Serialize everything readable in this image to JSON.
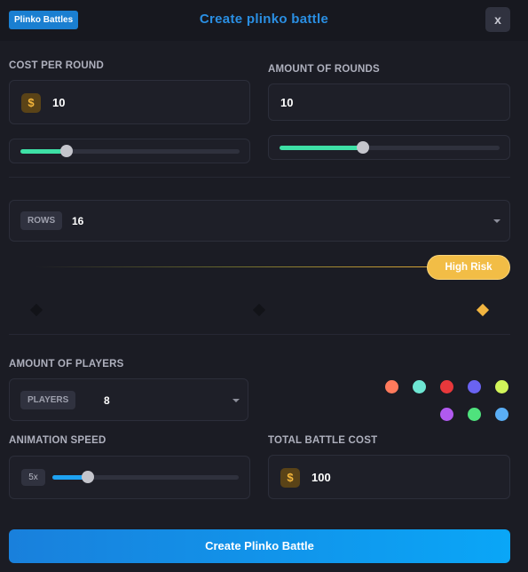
{
  "header": {
    "tag": "Plinko Battles",
    "title": "Create plinko battle",
    "close_label": "x"
  },
  "cost_per_round": {
    "label": "COST PER ROUND",
    "currency_symbol": "$",
    "value": "10",
    "slider_fraction": 0.21
  },
  "amount_of_rounds": {
    "label": "AMOUNT OF ROUNDS",
    "value": "10",
    "slider_fraction": 0.38
  },
  "rows": {
    "label": "ROWS",
    "value": "16"
  },
  "risk": {
    "selected_label": "High Risk",
    "levels": [
      "low",
      "medium",
      "high"
    ],
    "selected": "high"
  },
  "players": {
    "section_label": "AMOUNT OF PLAYERS",
    "label": "PLAYERS",
    "value": "8",
    "colors": [
      "#ff7a5c",
      "#6ee6d3",
      "#e8383b",
      "#6a63f2",
      "#d2f55a",
      "#b15af0",
      "#4fe27d",
      "#5aaef5"
    ]
  },
  "animation_speed": {
    "label": "ANIMATION SPEED",
    "value": "5x",
    "slider_fraction": 0.19
  },
  "total_cost": {
    "label": "TOTAL BATTLE COST",
    "currency_symbol": "$",
    "value": "100"
  },
  "cta": {
    "label": "Create Plinko Battle"
  },
  "colors": {
    "background": "#1b1c24",
    "accent_blue": "#1a7fd1",
    "slider_green": "#3ee0a6",
    "slider_blue": "#1ea2f2",
    "risk_yellow": "#f2bd46"
  }
}
